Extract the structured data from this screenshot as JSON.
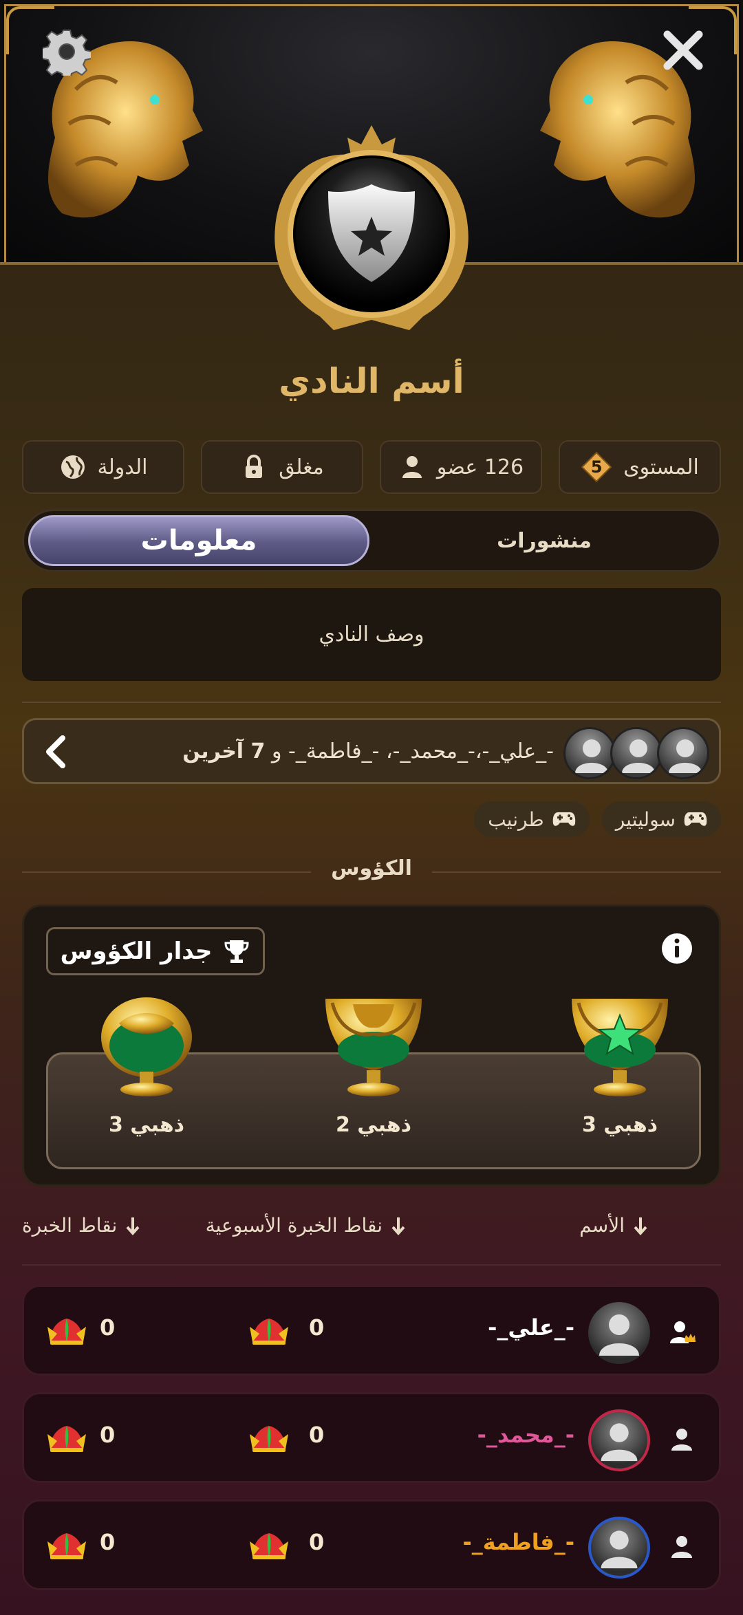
{
  "club": {
    "name": "أسم النادي"
  },
  "stats": {
    "level_label": "المستوى",
    "level_value": "5",
    "members": "126 عضو",
    "status": "مغلق",
    "country": "الدولة"
  },
  "tabs": {
    "info": "معلومات",
    "posts": "منشورات"
  },
  "description": "وصف النادي",
  "members_row": {
    "names": "-_علي_-،-_محمد_-، -_فاطمة_- و",
    "others": "7 آخرين"
  },
  "games": [
    "سوليتير",
    "طرنيب"
  ],
  "trophies": {
    "section_title": "الكؤوس",
    "wall_button": "جدار الكؤوس",
    "items": [
      {
        "label": "ذهبي 3"
      },
      {
        "label": "ذهبي 2"
      },
      {
        "label": "ذهبي 3"
      }
    ]
  },
  "table": {
    "headers": {
      "name": "الأسم",
      "weekly_xp": "نقاط الخبرة الأسبوعية",
      "xp": "نقاط الخبرة"
    },
    "rows": [
      {
        "name": "-_علي_-",
        "name_color": "#ffffff",
        "weekly": "0",
        "xp": "0",
        "role": "leader"
      },
      {
        "name": "-_محمد_-",
        "name_color": "#e0589a",
        "weekly": "0",
        "xp": "0",
        "role": "member"
      },
      {
        "name": "-_فاطمة_-",
        "name_color": "#f0a020",
        "weekly": "0",
        "xp": "0",
        "role": "member"
      }
    ]
  },
  "colors": {
    "gold": "#e0b668",
    "tab_active": "#5d5a85"
  }
}
